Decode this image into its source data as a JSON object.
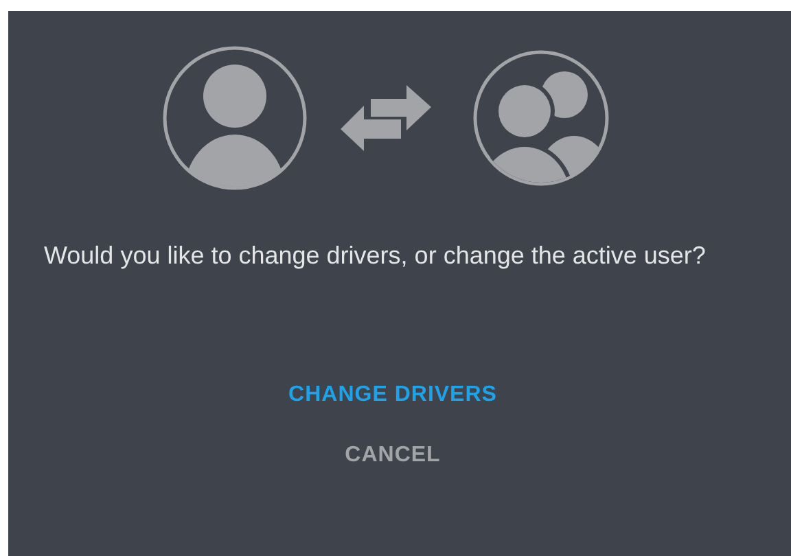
{
  "message": "Would you like to change drivers, or change the active user?",
  "buttons": [
    {
      "label": "CHANGE DRIVERS",
      "kind": "primary"
    },
    {
      "label": "CANCEL",
      "kind": "secondary"
    }
  ]
}
